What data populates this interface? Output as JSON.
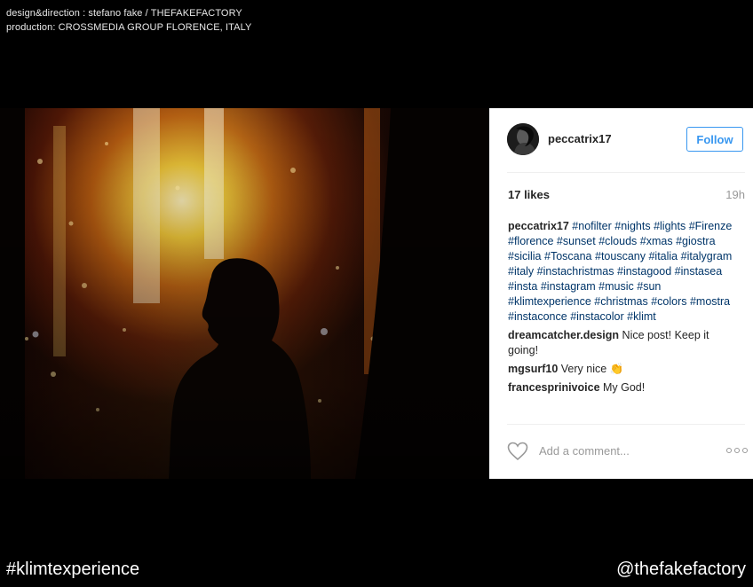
{
  "credits": {
    "line1": "design&direction : stefano fake / THEFAKEFACTORY",
    "line2": "production: CROSSMEDIA GROUP FLORENCE, ITALY"
  },
  "post": {
    "username": "peccatrix17",
    "follow_label": "Follow",
    "likes": "17 likes",
    "time": "19h",
    "caption": {
      "author": "peccatrix17",
      "hashtags": [
        "#nofilter",
        "#nights",
        "#lights",
        "#Firenze",
        "#florence",
        "#sunset",
        "#clouds",
        "#xmas",
        "#giostra",
        "#sicilia",
        "#Toscana",
        "#touscany",
        "#italia",
        "#italygram",
        "#italy",
        "#instachristmas",
        "#instagood",
        "#instasea",
        "#insta",
        "#instagram",
        "#music",
        "#sun",
        "#klimtexperience",
        "#christmas",
        "#colors",
        "#mostra",
        "#instaconce",
        "#instacolor",
        "#klimt"
      ]
    },
    "comments": [
      {
        "author": "dreamcatcher.design",
        "text": "Nice post! Keep it going!"
      },
      {
        "author": "mgsurf10",
        "text": "Very nice 👏"
      },
      {
        "author": "francesprinivoice",
        "text": "My God!"
      }
    ],
    "add_comment_placeholder": "Add a comment..."
  },
  "footer": {
    "left": "#klimtexperience",
    "right": "@thefakefactory"
  },
  "colors": {
    "link_blue": "#3897f0",
    "hashtag_blue": "#003569",
    "background": "#000000"
  },
  "icons": {
    "heart": "heart-icon",
    "more": "more-options-icon"
  }
}
